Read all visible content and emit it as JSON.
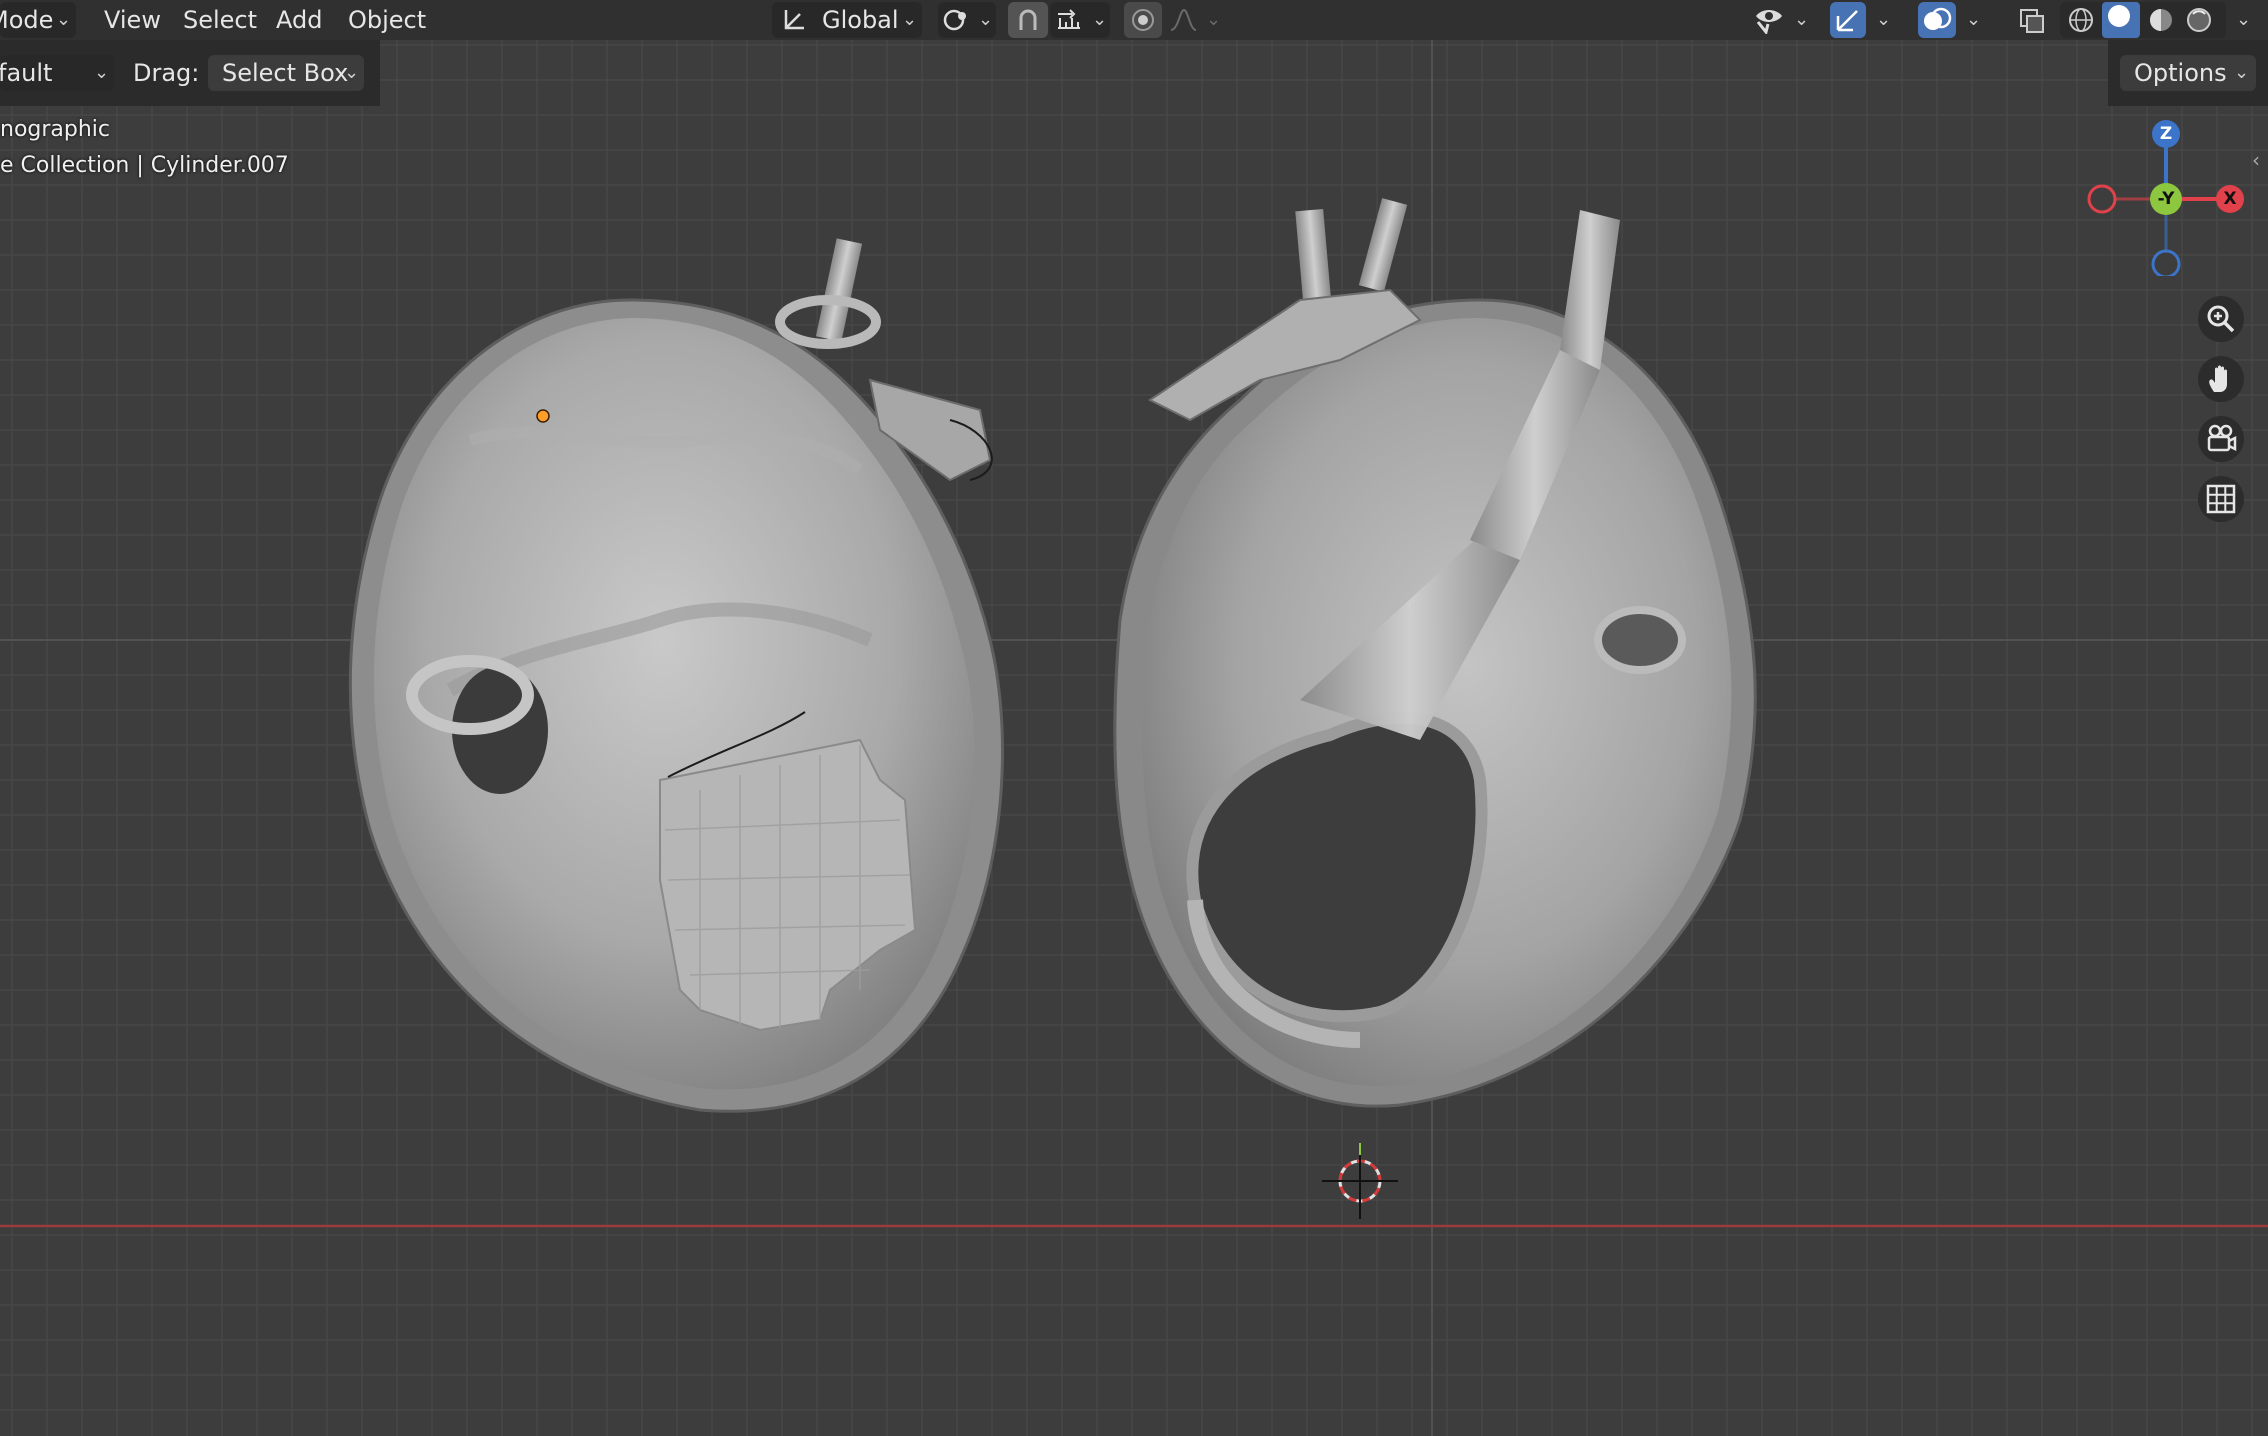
{
  "header": {
    "mode_label": "Mode",
    "menu": [
      "View",
      "Select",
      "Add",
      "Object"
    ],
    "transform_orientation": "Global"
  },
  "toolbar": {
    "keymap_label": "fault",
    "drag_label": "Drag:",
    "drag_value": "Select Box",
    "options_label": "Options"
  },
  "viewport": {
    "view_name": "nographic",
    "object_info": "e Collection | Cylinder.007"
  },
  "gizmo": {
    "z_label": "Z",
    "y_label": "-Y",
    "x_label": "X",
    "colors": {
      "x": "#e0414a",
      "y": "#8dc63f",
      "z": "#3b74c9"
    }
  },
  "icons": [
    "transform-orientation-icon",
    "pivot-icon",
    "snap-icon",
    "snap-increment-icon",
    "proportional-edit-icon",
    "falloff-icon",
    "visibility-icon",
    "gizmo-icon",
    "overlay-icon",
    "xray-icon",
    "wireframe-shading-icon",
    "solid-shading-icon",
    "material-shading-icon",
    "rendered-shading-icon",
    "zoom-icon",
    "pan-hand-icon",
    "camera-icon",
    "grid-view-icon",
    "3d-cursor-icon"
  ]
}
